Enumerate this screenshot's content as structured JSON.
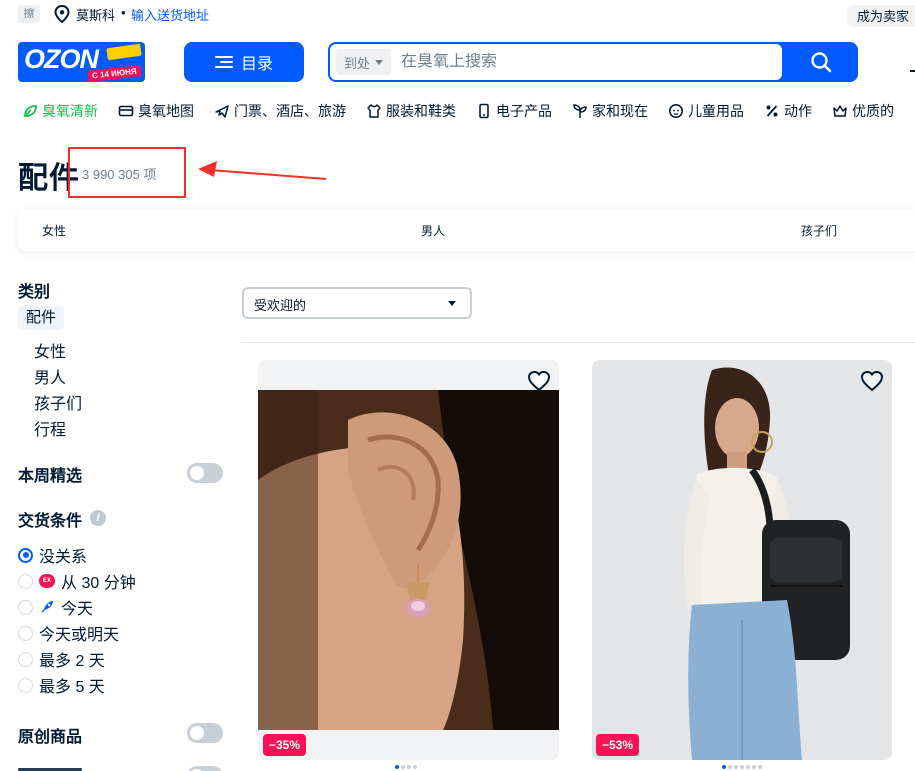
{
  "topbar": {
    "small_tag": "擦",
    "city": "莫斯科",
    "separator": "•",
    "address_link": "输入送货地址",
    "seller_link": "成为卖家"
  },
  "header": {
    "logo_text": "OZON",
    "logo_badge": "С 14 ИЮНЯ",
    "catalog_label": "目录",
    "search_scope": "到处",
    "search_placeholder": "在臭氧上搜索"
  },
  "category_nav": [
    {
      "label": "臭氧清新",
      "icon": "leaf-icon"
    },
    {
      "label": "臭氧地图",
      "icon": "card-icon"
    },
    {
      "label": "门票、酒店、旅游",
      "icon": "plane-icon"
    },
    {
      "label": "服装和鞋类",
      "icon": "tshirt-icon"
    },
    {
      "label": "电子产品",
      "icon": "phone-icon"
    },
    {
      "label": "家和现在",
      "icon": "plant-icon"
    },
    {
      "label": "儿童用品",
      "icon": "child-icon"
    },
    {
      "label": "动作",
      "icon": "percent-icon"
    },
    {
      "label": "优质的",
      "icon": "crown-icon"
    }
  ],
  "page": {
    "title": "配件",
    "count": "3 990 305 项"
  },
  "gender_tabs": [
    "女性",
    "男人",
    "孩子们"
  ],
  "sidebar": {
    "category_heading": "类别",
    "current_category": "配件",
    "subcategories": [
      "女性",
      "男人",
      "孩子们",
      "行程"
    ],
    "week_pick_label": "本周精选",
    "delivery_heading": "交货条件",
    "delivery_options": [
      {
        "label": "没关系",
        "selected": true,
        "icon": ""
      },
      {
        "label": "从 30 分钟",
        "selected": false,
        "icon": "express-icon"
      },
      {
        "label": "今天",
        "selected": false,
        "icon": "rocket-icon"
      },
      {
        "label": "今天或明天",
        "selected": false,
        "icon": ""
      },
      {
        "label": "最多 2 天",
        "selected": false,
        "icon": ""
      },
      {
        "label": "最多 5 天",
        "selected": false,
        "icon": ""
      }
    ],
    "original_label": "原创商品"
  },
  "sort": {
    "selected": "受欢迎的"
  },
  "products": [
    {
      "discount": "−35%",
      "image": "earring-photo",
      "dots_total": 4,
      "dots_active": 1
    },
    {
      "discount": "−53%",
      "image": "backpack-photo",
      "dots_total": 7,
      "dots_active": 1
    }
  ],
  "colors": {
    "brand_blue": "#005bff",
    "discount_pink": "#f91155",
    "annotation_red": "#f0302c",
    "fresh_green": "#10c44c"
  }
}
